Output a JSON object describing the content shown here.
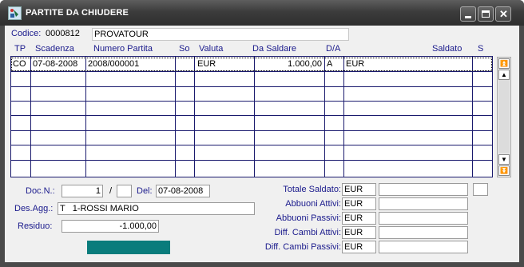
{
  "window": {
    "title": "PARTITE DA CHIUDERE"
  },
  "codice": {
    "label": "Codice:",
    "code": "0000812",
    "name": "PROVATOUR"
  },
  "columns": [
    "TP",
    "Scadenza",
    "Numero Partita",
    "So",
    "Valuta",
    "Da Saldare",
    "D/A",
    "Saldato",
    "S"
  ],
  "row": {
    "tp": "CO",
    "scadenza": "07-08-2008",
    "numero": "2008/000001",
    "so": "",
    "valuta": "EUR",
    "da_saldare": "1.000,00",
    "da": "A",
    "saldato_valuta": "EUR"
  },
  "doc": {
    "label": "Doc.N.:",
    "number": "1",
    "sep": "/",
    "suffix": "",
    "del_label": "Del:",
    "date": "07-08-2008"
  },
  "des_agg": {
    "label": "Des.Agg.:",
    "value": "T   1-ROSSI MARIO"
  },
  "residuo": {
    "label": "Residuo:",
    "value": "-1.000,00"
  },
  "totals": [
    {
      "label": "Totale Saldato:",
      "currency": "EUR",
      "value": ""
    },
    {
      "label": "Abbuoni Attivi:",
      "currency": "EUR",
      "value": ""
    },
    {
      "label": "Abbuoni Passivi:",
      "currency": "EUR",
      "value": ""
    },
    {
      "label": "Diff. Cambi Attivi:",
      "currency": "EUR",
      "value": ""
    },
    {
      "label": "Diff. Cambi Passivi:",
      "currency": "EUR",
      "value": ""
    }
  ],
  "icons": {
    "app": "app-icon",
    "minimize": "minimize-icon",
    "maximize": "maximize-icon",
    "close": "close-icon"
  },
  "colors": {
    "title_bar": "#3c3c3c",
    "grid_line": "#1a1a6e",
    "label": "#1a1a8c",
    "teal_button": "#0a7c7c"
  }
}
